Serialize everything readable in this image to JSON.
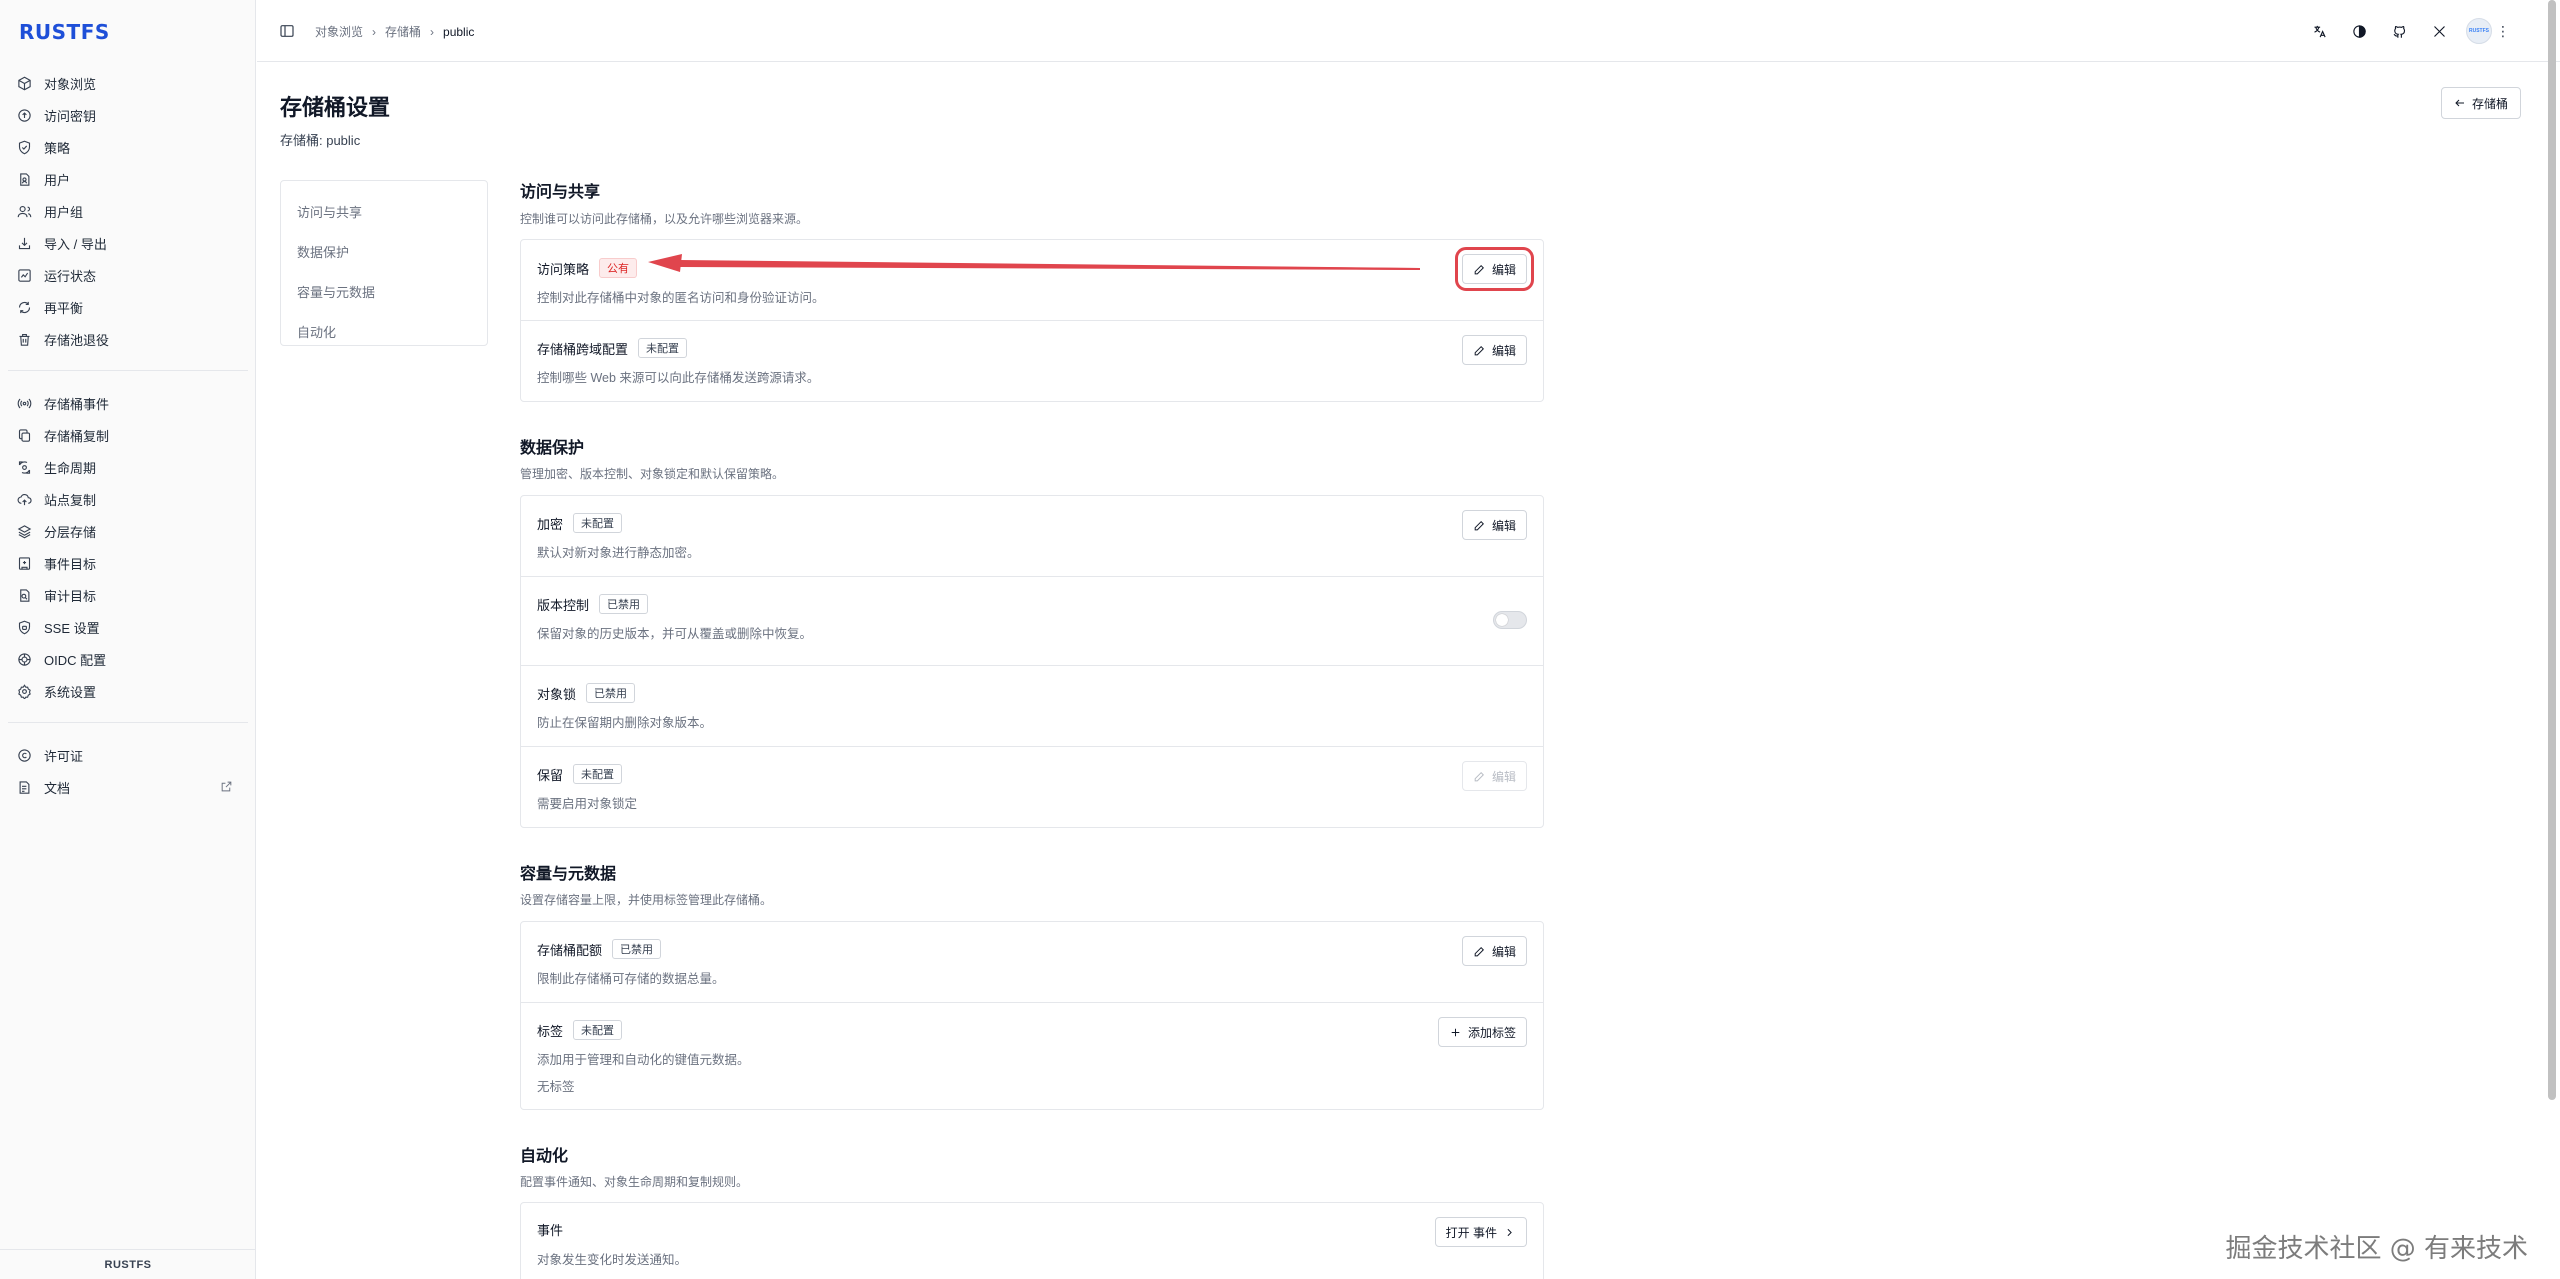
{
  "brand": {
    "logo": "RUSTFS",
    "footer": "RUSTFS"
  },
  "sidebar": {
    "group1": [
      {
        "label": "对象浏览",
        "icon": "cube-icon"
      },
      {
        "label": "访问密钥",
        "icon": "key-icon"
      },
      {
        "label": "策略",
        "icon": "shield-check-icon"
      },
      {
        "label": "用户",
        "icon": "user-icon"
      },
      {
        "label": "用户组",
        "icon": "users-icon"
      },
      {
        "label": "导入 / 导出",
        "icon": "transfer-icon"
      },
      {
        "label": "运行状态",
        "icon": "status-icon"
      },
      {
        "label": "再平衡",
        "icon": "rebalance-icon"
      },
      {
        "label": "存储池退役",
        "icon": "trash-icon"
      }
    ],
    "group2": [
      {
        "label": "存储桶事件",
        "icon": "broadcast-icon"
      },
      {
        "label": "存储桶复制",
        "icon": "copy-icon"
      },
      {
        "label": "生命周期",
        "icon": "lifecycle-icon"
      },
      {
        "label": "站点复制",
        "icon": "cloud-upload-icon"
      },
      {
        "label": "分层存储",
        "icon": "layers-icon"
      },
      {
        "label": "事件目标",
        "icon": "target-icon"
      },
      {
        "label": "审计目标",
        "icon": "audit-icon"
      },
      {
        "label": "SSE 设置",
        "icon": "lock-icon"
      },
      {
        "label": "OIDC 配置",
        "icon": "globe-icon"
      },
      {
        "label": "系统设置",
        "icon": "gear-icon"
      }
    ],
    "group3": [
      {
        "label": "许可证",
        "icon": "copyright-icon"
      },
      {
        "label": "文档",
        "icon": "document-icon"
      }
    ]
  },
  "breadcrumbs": [
    "对象浏览",
    "存储桶",
    "public"
  ],
  "topbar": {
    "avatar_text": "RUSTFS"
  },
  "page": {
    "title": "存储桶设置",
    "subtitle": "存储桶: public",
    "back_label": "存储桶"
  },
  "section_nav": [
    "访问与共享",
    "数据保护",
    "容量与元数据",
    "自动化"
  ],
  "sections": {
    "access": {
      "title": "访问与共享",
      "desc": "控制谁可以访问此存储桶，以及允许哪些浏览器来源。",
      "policy": {
        "name": "访问策略",
        "badge": "公有",
        "desc": "控制对此存储桶中对象的匿名访问和身份验证访问。",
        "button": "编辑"
      },
      "cors": {
        "name": "存储桶跨域配置",
        "badge": "未配置",
        "desc": "控制哪些 Web 来源可以向此存储桶发送跨源请求。",
        "button": "编辑"
      }
    },
    "protection": {
      "title": "数据保护",
      "desc": "管理加密、版本控制、对象锁定和默认保留策略。",
      "encryption": {
        "name": "加密",
        "badge": "未配置",
        "desc": "默认对新对象进行静态加密。",
        "button": "编辑"
      },
      "versioning": {
        "name": "版本控制",
        "badge": "已禁用",
        "desc": "保留对象的历史版本，并可从覆盖或删除中恢复。"
      },
      "objectlock": {
        "name": "对象锁",
        "badge": "已禁用",
        "desc": "防止在保留期内删除对象版本。"
      },
      "retention": {
        "name": "保留",
        "badge": "未配置",
        "desc": "需要启用对象锁定",
        "button": "编辑"
      }
    },
    "capacity": {
      "title": "容量与元数据",
      "desc": "设置存储容量上限，并使用标签管理此存储桶。",
      "quota": {
        "name": "存储桶配额",
        "badge": "已禁用",
        "desc": "限制此存储桶可存储的数据总量。",
        "button": "编辑"
      },
      "tags": {
        "name": "标签",
        "badge": "未配置",
        "desc": "添加用于管理和自动化的键值元数据。",
        "empty": "无标签",
        "button": "添加标签"
      }
    },
    "automation": {
      "title": "自动化",
      "desc": "配置事件通知、对象生命周期和复制规则。",
      "events": {
        "name": "事件",
        "desc": "对象发生变化时发送通知。",
        "button": "打开 事件"
      }
    }
  },
  "watermark": "掘金技术社区 @ 有来技术",
  "colors": {
    "brand": "#1e4fd8",
    "annotation": "#e0454d",
    "badge_public": "#dc2626"
  }
}
